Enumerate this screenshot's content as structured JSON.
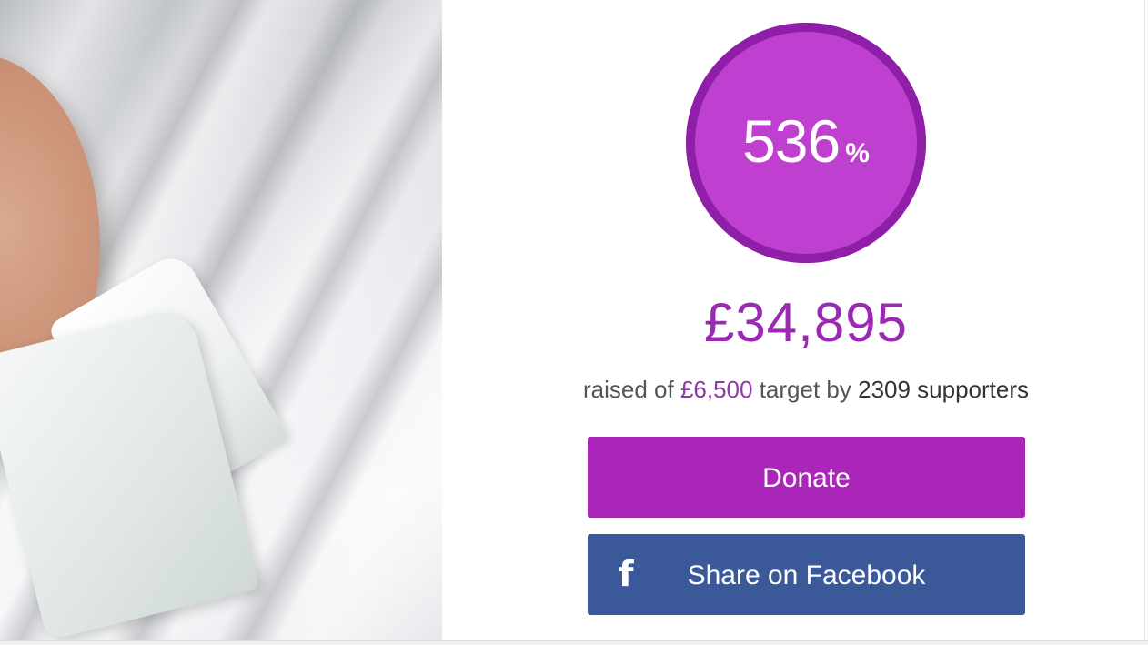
{
  "progress": {
    "percent_value": "536",
    "percent_sign": "%",
    "fraction_of_target": 5.36
  },
  "funds": {
    "raised": "£34,895",
    "raised_prefix": "raised of",
    "target": "£6,500",
    "target_suffix": "target by",
    "supporters": "2309 supporters"
  },
  "actions": {
    "donate_label": "Donate",
    "facebook_label": "Share on Facebook",
    "facebook_icon": "facebook-f-icon"
  },
  "colors": {
    "accent": "#aa26b8",
    "ring_fill": "#bf40d0",
    "ring_border": "#8f1fa8",
    "facebook": "#3b5998"
  }
}
